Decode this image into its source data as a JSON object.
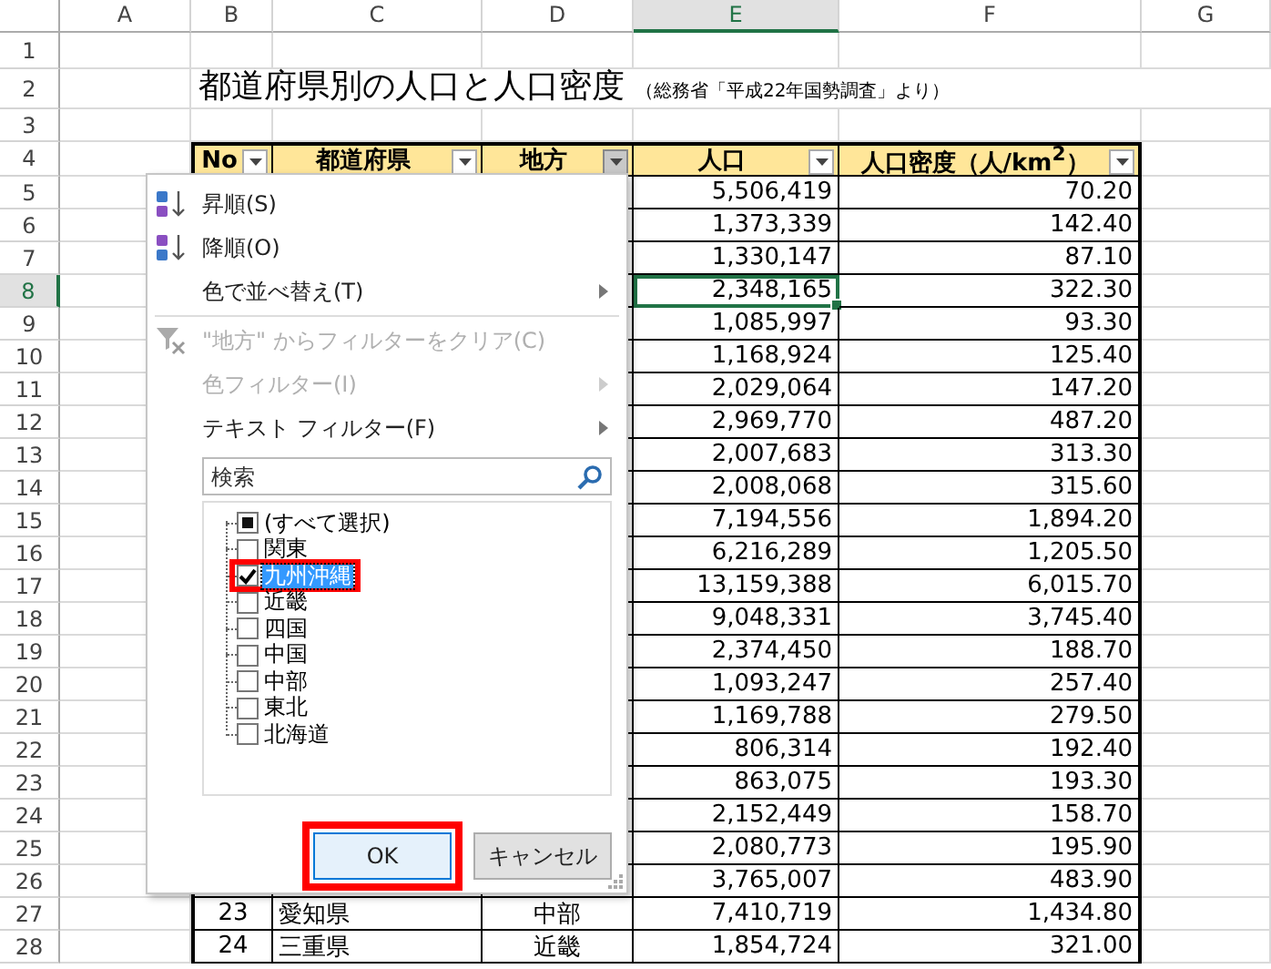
{
  "column_headers": [
    {
      "label": "A",
      "selected": false
    },
    {
      "label": "B",
      "selected": false
    },
    {
      "label": "C",
      "selected": false
    },
    {
      "label": "D",
      "selected": false
    },
    {
      "label": "E",
      "selected": true
    },
    {
      "label": "F",
      "selected": false
    },
    {
      "label": "G",
      "selected": false
    }
  ],
  "row_headers": [
    {
      "label": "1",
      "selected": false
    },
    {
      "label": "2",
      "selected": false
    },
    {
      "label": "3",
      "selected": false
    },
    {
      "label": "4",
      "selected": false
    },
    {
      "label": "5",
      "selected": false
    },
    {
      "label": "6",
      "selected": false
    },
    {
      "label": "7",
      "selected": false
    },
    {
      "label": "8",
      "selected": true
    },
    {
      "label": "9",
      "selected": false
    },
    {
      "label": "10",
      "selected": false
    },
    {
      "label": "11",
      "selected": false
    },
    {
      "label": "12",
      "selected": false
    },
    {
      "label": "13",
      "selected": false
    },
    {
      "label": "14",
      "selected": false
    },
    {
      "label": "15",
      "selected": false
    },
    {
      "label": "16",
      "selected": false
    },
    {
      "label": "17",
      "selected": false
    },
    {
      "label": "18",
      "selected": false
    },
    {
      "label": "19",
      "selected": false
    },
    {
      "label": "20",
      "selected": false
    },
    {
      "label": "21",
      "selected": false
    },
    {
      "label": "22",
      "selected": false
    },
    {
      "label": "23",
      "selected": false
    },
    {
      "label": "24",
      "selected": false
    },
    {
      "label": "25",
      "selected": false
    },
    {
      "label": "26",
      "selected": false
    },
    {
      "label": "27",
      "selected": false
    },
    {
      "label": "28",
      "selected": false
    }
  ],
  "title": "都道府県別の人口と人口密度",
  "subtitle": "（総務省「平成22年国勢調査」より）",
  "table": {
    "columns": [
      {
        "label": "No",
        "open": false
      },
      {
        "label": "都道府県",
        "open": false
      },
      {
        "label": "地方",
        "open": true
      },
      {
        "label": "人口",
        "open": false
      },
      {
        "label": "人口密度（人/km$^{2}$）",
        "open": false
      }
    ],
    "rows": [
      {
        "population": "5,506,419",
        "density": "70.20",
        "selected": false
      },
      {
        "population": "1,373,339",
        "density": "142.40",
        "selected": false
      },
      {
        "population": "1,330,147",
        "density": "87.10",
        "selected": false
      },
      {
        "population": "2,348,165",
        "density": "322.30",
        "selected": true
      },
      {
        "population": "1,085,997",
        "density": "93.30",
        "selected": false
      },
      {
        "population": "1,168,924",
        "density": "125.40",
        "selected": false
      },
      {
        "population": "2,029,064",
        "density": "147.20",
        "selected": false
      },
      {
        "population": "2,969,770",
        "density": "487.20",
        "selected": false
      },
      {
        "population": "2,007,683",
        "density": "313.30",
        "selected": false
      },
      {
        "population": "2,008,068",
        "density": "315.60",
        "selected": false
      },
      {
        "population": "7,194,556",
        "density": "1,894.20",
        "selected": false
      },
      {
        "population": "6,216,289",
        "density": "1,205.50",
        "selected": false
      },
      {
        "population": "13,159,388",
        "density": "6,015.70",
        "selected": false
      },
      {
        "population": "9,048,331",
        "density": "3,745.40",
        "selected": false
      },
      {
        "population": "2,374,450",
        "density": "188.70",
        "selected": false
      },
      {
        "population": "1,093,247",
        "density": "257.40",
        "selected": false
      },
      {
        "population": "1,169,788",
        "density": "279.50",
        "selected": false
      },
      {
        "population": "806,314",
        "density": "192.40",
        "selected": false
      },
      {
        "population": "863,075",
        "density": "193.30",
        "selected": false
      },
      {
        "population": "2,152,449",
        "density": "158.70",
        "selected": false
      },
      {
        "population": "2,080,773",
        "density": "195.90",
        "selected": false
      },
      {
        "population": "3,765,007",
        "density": "483.90",
        "selected": false
      },
      {
        "no": "23",
        "prefecture": "愛知県",
        "region": "中部",
        "population": "7,410,719",
        "density": "1,434.80",
        "selected": false
      },
      {
        "no": "24",
        "prefecture": "三重県",
        "region": "近畿",
        "population": "1,854,724",
        "density": "321.00",
        "selected": false
      }
    ]
  },
  "filter_menu": {
    "items": [
      {
        "kind": "sort-asc",
        "label": "昇順(S)",
        "disabled": false,
        "submenu": false
      },
      {
        "kind": "sort-desc",
        "label": "降順(O)",
        "disabled": false,
        "submenu": false
      },
      {
        "kind": "plain",
        "label": "色で並べ替え(T)",
        "disabled": false,
        "submenu": true
      },
      {
        "kind": "separator"
      },
      {
        "kind": "clear-filter",
        "label": "\"地方\" からフィルターをクリア(C)",
        "disabled": true,
        "submenu": false
      },
      {
        "kind": "plain",
        "label": "色フィルター(I)",
        "disabled": true,
        "submenu": true
      },
      {
        "kind": "plain",
        "label": "テキスト フィルター(F)",
        "disabled": false,
        "submenu": true
      }
    ],
    "search": {
      "placeholder": "検索"
    },
    "options": [
      {
        "label": "(すべて選択)",
        "checked": false,
        "indeterminate": true,
        "selected": false,
        "annotated": false
      },
      {
        "label": "関東",
        "checked": false,
        "indeterminate": false,
        "selected": false,
        "annotated": false
      },
      {
        "label": "九州沖縄",
        "checked": true,
        "indeterminate": false,
        "selected": true,
        "annotated": true
      },
      {
        "label": "近畿",
        "checked": false,
        "indeterminate": false,
        "selected": false,
        "annotated": false
      },
      {
        "label": "四国",
        "checked": false,
        "indeterminate": false,
        "selected": false,
        "annotated": false
      },
      {
        "label": "中国",
        "checked": false,
        "indeterminate": false,
        "selected": false,
        "annotated": false
      },
      {
        "label": "中部",
        "checked": false,
        "indeterminate": false,
        "selected": false,
        "annotated": false
      },
      {
        "label": "東北",
        "checked": false,
        "indeterminate": false,
        "selected": false,
        "annotated": false
      },
      {
        "label": "北海道",
        "checked": false,
        "indeterminate": false,
        "selected": false,
        "annotated": false
      }
    ],
    "buttons": [
      {
        "label": "OK",
        "focused": true,
        "annotated": true
      },
      {
        "label": "キャンセル",
        "focused": false,
        "annotated": false
      }
    ]
  }
}
